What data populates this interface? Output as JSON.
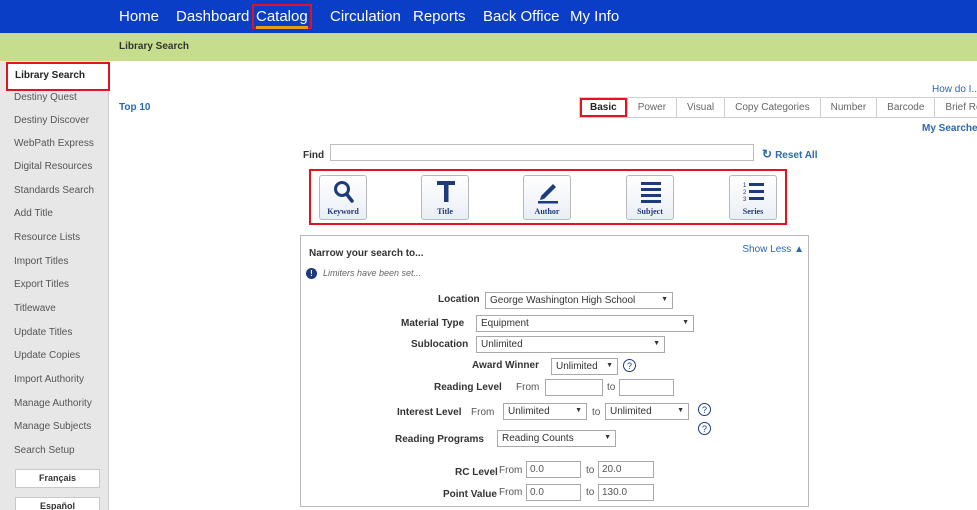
{
  "nav": {
    "items": [
      "Home",
      "Dashboard",
      "Catalog",
      "Circulation",
      "Reports",
      "Back Office",
      "My Info"
    ]
  },
  "breadcrumb": "Library Search",
  "sidebar": {
    "items": [
      "Library Search",
      "Destiny Quest",
      "Destiny Discover",
      "WebPath Express",
      "Digital Resources",
      "Standards Search",
      "Add Title",
      "Resource Lists",
      "Import Titles",
      "Export Titles",
      "Titlewave",
      "Update Titles",
      "Update Copies",
      "Import Authority",
      "Manage Authority",
      "Manage Subjects",
      "Search Setup"
    ],
    "lang_buttons": [
      "Français",
      "Español"
    ]
  },
  "top10": "Top 10",
  "how_do_i": "How do I...",
  "tabs": [
    "Basic",
    "Power",
    "Visual",
    "Copy Categories",
    "Number",
    "Barcode",
    "Brief Records"
  ],
  "my_searches": "My Searches",
  "find": {
    "label": "Find",
    "value": "",
    "reset": "Reset All"
  },
  "search_buttons": [
    "Keyword",
    "Title",
    "Author",
    "Subject",
    "Series"
  ],
  "narrow": {
    "title": "Narrow your search to...",
    "show_less": "Show Less",
    "limiters_note": "Limiters have been set...",
    "location_label": "Location",
    "location_value": "George Washington High School",
    "material_label": "Material Type",
    "material_value": "Equipment",
    "sublocation_label": "Sublocation",
    "sublocation_value": "Unlimited",
    "award_label": "Award Winner",
    "award_value": "Unlimited",
    "reading_level_label": "Reading Level",
    "from_text": "From",
    "to_text": "to",
    "interest_label": "Interest Level",
    "interest_from": "Unlimited",
    "interest_to": "Unlimited",
    "programs_label": "Reading Programs",
    "programs_value": "Reading Counts",
    "rc_label": "RC Level",
    "rc_from": "0.0",
    "rc_to": "20.0",
    "point_label": "Point Value",
    "point_from": "0.0",
    "point_to": "130.0"
  }
}
